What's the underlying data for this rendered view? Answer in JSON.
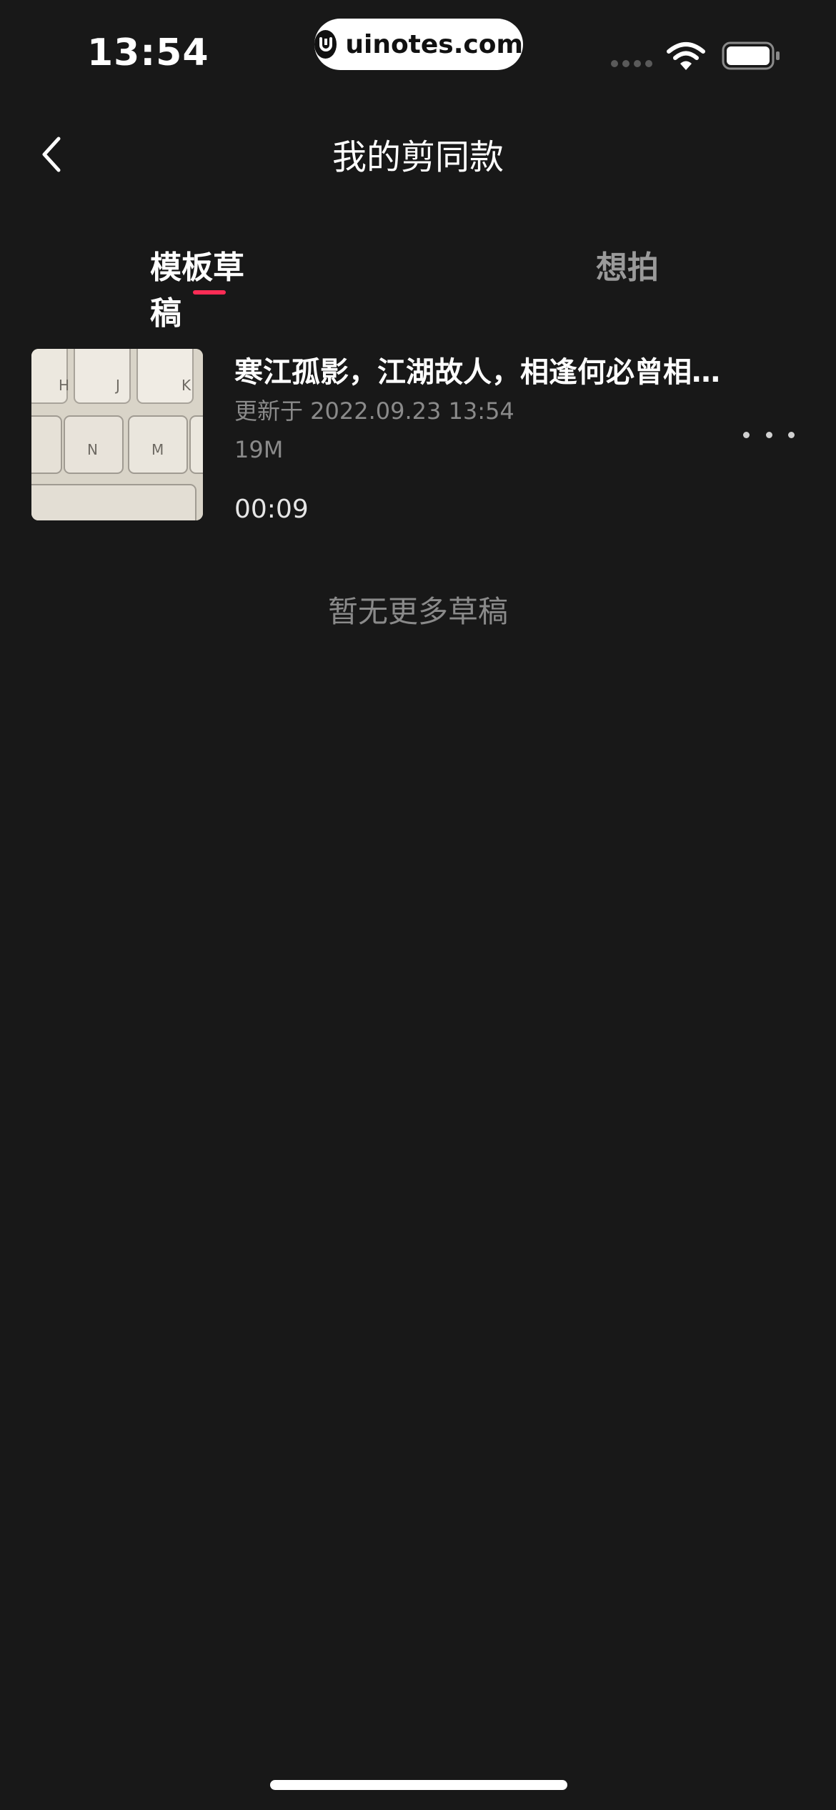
{
  "status_bar": {
    "time": "13:54",
    "watermark": "uinotes.com",
    "icons": [
      "signal-icon",
      "wifi-icon",
      "battery-icon"
    ]
  },
  "nav": {
    "title": "我的剪同款",
    "back_icon": "chevron-left-icon"
  },
  "tabs": [
    {
      "label": "模板草稿",
      "active": true
    },
    {
      "label": "想拍",
      "active": false
    }
  ],
  "drafts": [
    {
      "title": "寒江孤影，江湖故人，相逢何必曾相…",
      "updated": "更新于 2022.09.23 13:54",
      "size": "19M",
      "duration": "00:09",
      "more_icon": "more-horizontal-icon"
    }
  ],
  "empty_hint": "暂无更多草稿",
  "colors": {
    "background": "#181818",
    "accent": "#fe2c55",
    "text_primary": "#ffffff",
    "text_secondary": "#8a8a8a"
  }
}
